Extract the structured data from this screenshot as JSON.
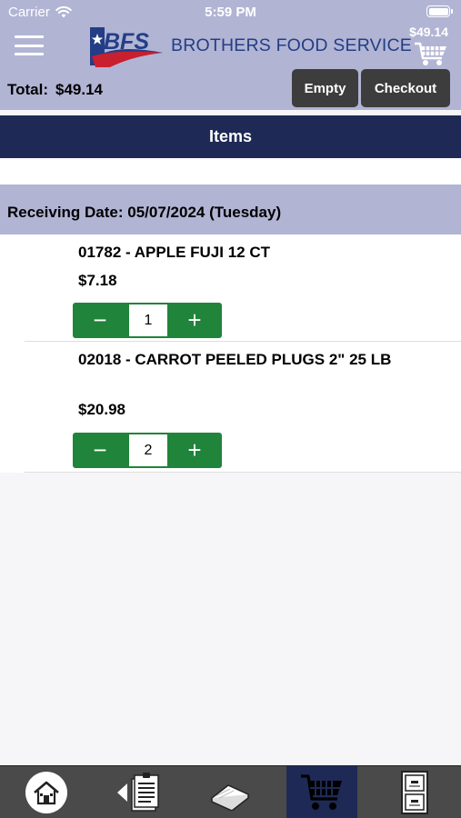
{
  "status_bar": {
    "carrier": "Carrier",
    "time": "5:59 PM"
  },
  "header": {
    "brand_initials": "BFS",
    "brand_name": "BROTHERS FOOD SERVICE",
    "cart_total": "$49.14"
  },
  "summary": {
    "total_label": "Total:",
    "total_value": "$49.14",
    "empty_label": "Empty",
    "checkout_label": "Checkout"
  },
  "section_title": "Items",
  "receiving_date": "Receiving Date: 05/07/2024 (Tuesday)",
  "items": [
    {
      "title": "01782 - APPLE FUJI 12 CT",
      "price": "$7.18",
      "quantity": "1"
    },
    {
      "title": "02018 - CARROT PEELED PLUGS 2\" 25 LB",
      "price": "$20.98",
      "quantity": "2"
    }
  ],
  "stepper": {
    "minus": "−",
    "plus": "+"
  },
  "tabbar": {
    "tabs": [
      {
        "icon": "home-icon"
      },
      {
        "icon": "order-list-icon"
      },
      {
        "icon": "catalog-book-icon"
      },
      {
        "icon": "cart-icon",
        "active": true
      },
      {
        "icon": "file-cabinet-icon"
      }
    ]
  },
  "colors": {
    "header_bg": "#b2b4d4",
    "navy": "#1e2a55",
    "stepper_green": "#20843a",
    "dark_button": "#3d3d3d",
    "tabbar_bg": "#4a4a4a",
    "brand_blue": "#233e86",
    "brand_red": "#c8202f"
  }
}
